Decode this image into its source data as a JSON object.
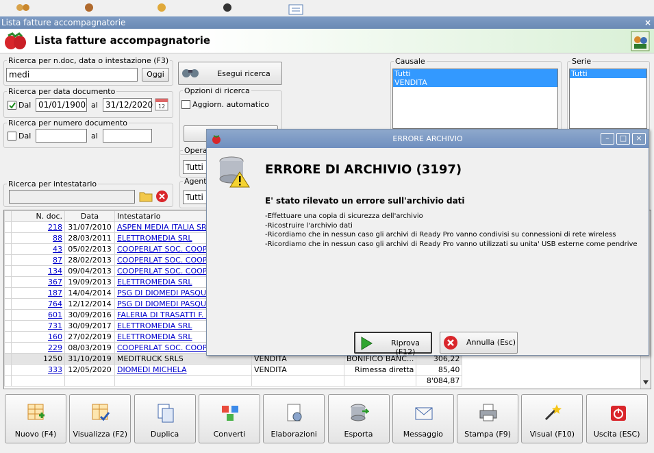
{
  "window": {
    "title": "Lista fatture accompagnatorie",
    "close": "×"
  },
  "header": {
    "title": "Lista fatture accompagnatorie"
  },
  "search_text": {
    "legend": "Ricerca per n.doc, data o intestazione (F3)",
    "value": "medi",
    "today_label": "Oggi"
  },
  "search_button": "Esegui ricerca",
  "date_search": {
    "legend": "Ricerca per data documento",
    "dal_label": "Dal",
    "al_label": "al",
    "from": "01/01/1900",
    "to": "31/12/2020",
    "dal_checked": true
  },
  "number_search": {
    "legend": "Ricerca per numero documento",
    "dal_label": "Dal",
    "al_label": "al",
    "from": "",
    "to": ""
  },
  "holder_search": {
    "legend": "Ricerca per intestatario",
    "value": ""
  },
  "options": {
    "legend": "Opzioni di ricerca",
    "auto_update": "Aggiorn. automatico"
  },
  "operatore": {
    "legend": "Operat",
    "value": "Tutti"
  },
  "agente": {
    "legend": "Agente",
    "value": "Tutti"
  },
  "causale": {
    "legend": "Causale",
    "items": [
      "Tutti",
      "VENDITA"
    ]
  },
  "serie": {
    "legend": "Serie",
    "items": [
      "Tutti"
    ]
  },
  "grid": {
    "headers": [
      "N. doc.",
      "Data",
      "Intestatario"
    ],
    "rows": [
      {
        "n": "218",
        "date": "31/07/2010",
        "holder": "ASPEN MEDIA ITALIA SRL",
        "causale": "",
        "payment": "",
        "amount": ""
      },
      {
        "n": "88",
        "date": "28/03/2011",
        "holder": "ELETTROMEDIA SRL",
        "causale": "",
        "payment": "",
        "amount": ""
      },
      {
        "n": "43",
        "date": "05/02/2013",
        "holder": "COOPERLAT SOC. COOP. A",
        "causale": "",
        "payment": "",
        "amount": ""
      },
      {
        "n": "87",
        "date": "28/02/2013",
        "holder": "COOPERLAT SOC. COOP. A",
        "causale": "",
        "payment": "",
        "amount": ""
      },
      {
        "n": "134",
        "date": "09/04/2013",
        "holder": "COOPERLAT SOC. COOP. A",
        "causale": "",
        "payment": "",
        "amount": ""
      },
      {
        "n": "367",
        "date": "19/09/2013",
        "holder": "ELETTROMEDIA SRL",
        "causale": "",
        "payment": "",
        "amount": ""
      },
      {
        "n": "187",
        "date": "14/04/2014",
        "holder": "PSG DI DIOMEDI PASQUALE",
        "causale": "",
        "payment": "",
        "amount": ""
      },
      {
        "n": "764",
        "date": "12/12/2014",
        "holder": "PSG DI DIOMEDI PASQUALE",
        "causale": "",
        "payment": "",
        "amount": ""
      },
      {
        "n": "601",
        "date": "30/09/2016",
        "holder": "FALERIA DI TRASATTI F. D.",
        "causale": "",
        "payment": "",
        "amount": ""
      },
      {
        "n": "731",
        "date": "30/09/2017",
        "holder": "ELETTROMEDIA SRL",
        "causale": "",
        "payment": "",
        "amount": ""
      },
      {
        "n": "160",
        "date": "27/02/2019",
        "holder": "ELETTROMEDIA SRL",
        "causale": "",
        "payment": "",
        "amount": ""
      },
      {
        "n": "229",
        "date": "08/03/2019",
        "holder": "COOPERLAT SOC. COOP. A",
        "causale": "",
        "payment": "",
        "amount": ""
      },
      {
        "n": "1250",
        "date": "31/10/2019",
        "holder": "MEDITRUCK SRLS",
        "causale": "VENDITA",
        "payment": "BONIFICO BANC...",
        "amount": "306,22"
      },
      {
        "n": "333",
        "date": "12/05/2020",
        "holder": "DIOMEDI MICHELA",
        "causale": "VENDITA",
        "payment": "Rimessa diretta",
        "amount": "85,40"
      }
    ],
    "total": "8'084,87"
  },
  "toolbar": [
    "Nuovo (F4)",
    "Visualizza (F2)",
    "Duplica",
    "Converti",
    "Elaborazioni",
    "Esporta",
    "Messaggio",
    "Stampa (F9)",
    "Visual (F10)",
    "Uscita (ESC)"
  ],
  "dialog": {
    "title": "ERRORE ARCHIVIO",
    "heading": "ERRORE DI ARCHIVIO (3197)",
    "subheading": "E' stato rilevato un errore sull'archivio dati",
    "lines": [
      "-Effettuare una copia di sicurezza dell'archivio",
      "-Ricostruire l'archivio dati",
      "-Ricordiamo che in nessun caso gli archivi di Ready Pro vanno condivisi su connessioni di rete wireless",
      "-Ricordiamo che in nessun caso gli archivi di Ready Pro vanno utilizzati su unita' USB esterne come pendrive"
    ],
    "retry": "Riprova (F12)",
    "cancel": "Annulla (Esc)"
  }
}
